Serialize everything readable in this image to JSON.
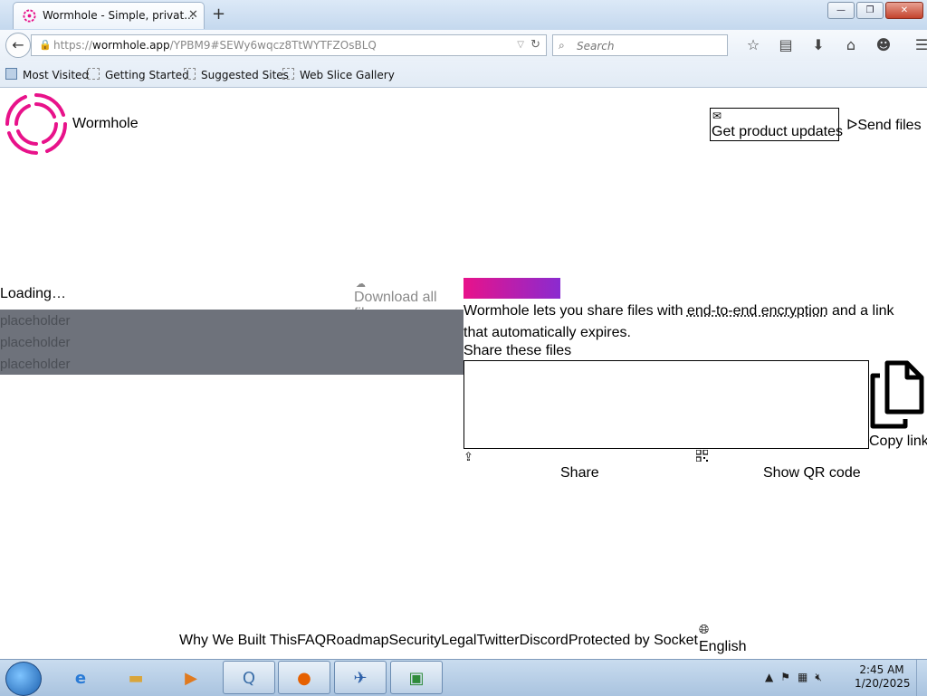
{
  "browser": {
    "tab_title": "Wormhole - Simple, privat...",
    "tab_close": "✕",
    "new_tab": "+",
    "url_prefix": "https://",
    "url_host": "wormhole.app",
    "url_path": "/YPBM9#SEWy6wqcz8TtWYTFZOsBLQ",
    "search_placeholder": "Search",
    "window_buttons": [
      "—",
      "❐",
      "✕"
    ],
    "bookmarks": [
      "Most Visited",
      "Getting Started",
      "Suggested Sites",
      "Web Slice Gallery"
    ]
  },
  "page": {
    "brand": "Wormhole",
    "updates_button": "Get product updates",
    "send_files": "Send files",
    "loading": "Loading…",
    "download_all": "Download all files",
    "placeholders": [
      "placeholder",
      "placeholder",
      "placeholder"
    ],
    "description_pre": "Wormhole lets you share files with ",
    "description_link": "end-to-end encryption",
    "description_post": " and a link that automatically expires.",
    "share_label": "Share these files",
    "copy_link": "Copy link",
    "share": "Share",
    "show_qr": "Show QR code",
    "footer_links": [
      "Why We Built This",
      "FAQ",
      "Roadmap",
      "Security",
      "Legal",
      "Twitter",
      "Discord",
      "Protected by Socket"
    ],
    "language": "English"
  },
  "taskbar": {
    "clock_time": "2:45 AM",
    "clock_date": "1/20/2025"
  },
  "colors": {
    "brand_pink": "#e8128a",
    "brand_purple": "#8a2bd0",
    "placeholder_bg": "#6e727b"
  }
}
